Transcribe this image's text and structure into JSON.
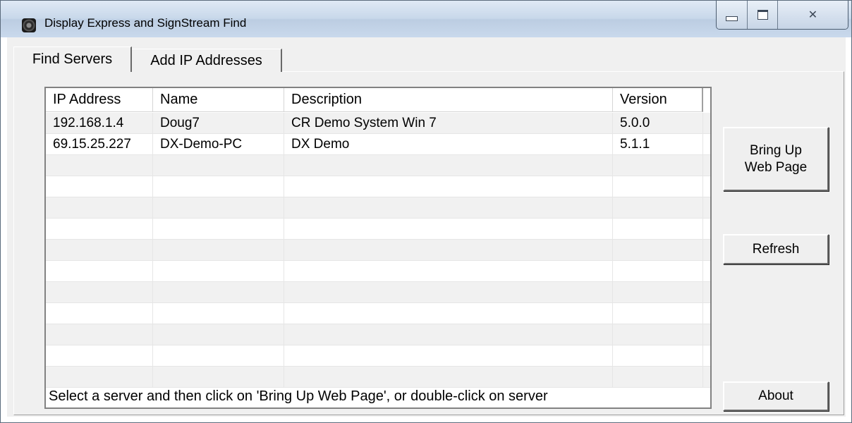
{
  "window": {
    "title": "Display Express and SignStream Find",
    "controls": {
      "minimize": "minimize",
      "maximize": "maximize",
      "close": "close"
    }
  },
  "tabs": [
    {
      "label": "Find Servers",
      "selected": true
    },
    {
      "label": "Add IP Addresses",
      "selected": false
    }
  ],
  "table": {
    "columns": [
      "IP Address",
      "Name",
      "Description",
      "Version"
    ],
    "rows": [
      [
        "192.168.1.4",
        "Doug7",
        "CR Demo System Win 7",
        "5.0.0"
      ],
      [
        "69.15.25.227",
        "DX-Demo-PC",
        "DX Demo",
        "5.1.1"
      ]
    ]
  },
  "buttons": {
    "bring_up_line1": "Bring Up",
    "bring_up_line2": "Web Page",
    "refresh": "Refresh",
    "about": "About"
  },
  "hint": "Select a server and then click on 'Bring Up Web Page', or double-click on server",
  "colors": {
    "titlebar": "#c9d9ec",
    "dialog": "#f0f0f0",
    "list_bg": "#ffffff"
  }
}
